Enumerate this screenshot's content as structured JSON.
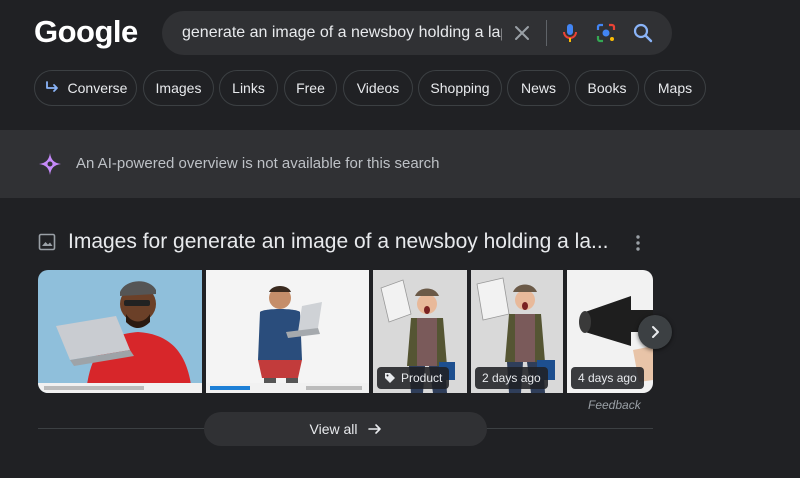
{
  "header": {
    "logo": "Google",
    "search": {
      "query": "generate an image of a newsboy holding a laptc",
      "icons": [
        "close-icon",
        "mic-icon",
        "lens-icon",
        "search-icon"
      ]
    }
  },
  "chips": [
    {
      "label": "Converse",
      "icon": "converse-arrow-icon"
    },
    {
      "label": "Images"
    },
    {
      "label": "Links"
    },
    {
      "label": "Free"
    },
    {
      "label": "Videos"
    },
    {
      "label": "Shopping"
    },
    {
      "label": "News"
    },
    {
      "label": "Books"
    },
    {
      "label": "Maps"
    }
  ],
  "ai_overview": {
    "text": "An AI-powered overview is not available for this search"
  },
  "images": {
    "title": "Images for generate an image of a newsboy holding a la...",
    "thumbnails": [
      {
        "badge": ""
      },
      {
        "badge": ""
      },
      {
        "badge": "Product",
        "badge_icon": "tag-icon"
      },
      {
        "badge": "2 days ago"
      },
      {
        "badge": "4 days ago"
      }
    ],
    "feedback": "Feedback",
    "view_all": "View all"
  },
  "colors": {
    "background": "#202124",
    "surface": "#303134",
    "text": "#e8eaed",
    "muted": "#9aa0a6",
    "accent_blue": "#8ab4f8",
    "ai_purple": "#c58af9"
  }
}
